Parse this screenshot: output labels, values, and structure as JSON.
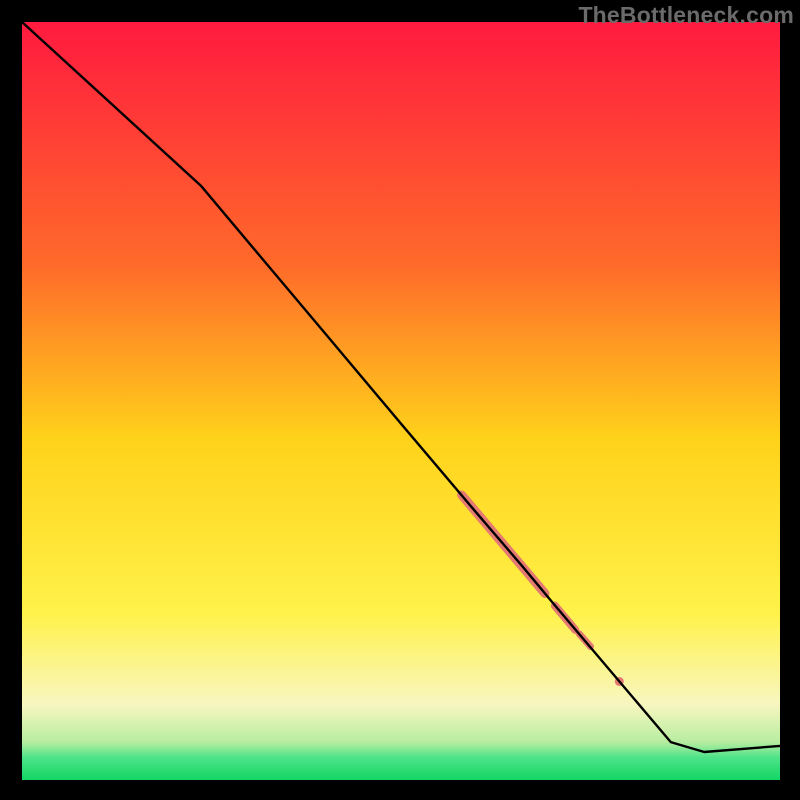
{
  "watermark": "TheBottleneck.com",
  "colors": {
    "red": "#ff1a3f",
    "orange": "#ff8a1f",
    "yellow": "#ffe617",
    "paleyellow": "#fdf6a7",
    "green": "#19e06b",
    "line": "#000000",
    "marker": "#e47a72",
    "bg": "#000000"
  },
  "chart_data": {
    "type": "line",
    "title": "",
    "xlabel": "",
    "ylabel": "",
    "xlim": [
      0,
      100
    ],
    "ylim": [
      0,
      100
    ],
    "grid": false,
    "legend": false,
    "description": "Monotonically decreasing bottleneck curve over a red→yellow→green vertical heat gradient. Thick salmon markers highlight a segment of the curve in the lower-right quadrant.",
    "series": [
      {
        "name": "bottleneck-curve",
        "x": [
          0.0,
          23.6,
          31.5,
          40.0,
          50.0,
          60.0,
          66.0,
          70.0,
          75.0,
          80.0,
          85.6,
          90.0,
          100.0
        ],
        "y": [
          100.0,
          78.4,
          69.0,
          58.9,
          47.0,
          35.2,
          28.2,
          23.4,
          17.5,
          11.6,
          5.0,
          3.7,
          4.5
        ]
      }
    ],
    "highlight_segments": [
      {
        "x": [
          58.0,
          69.0
        ],
        "y": [
          37.6,
          24.6
        ],
        "width": 9
      },
      {
        "x": [
          70.3,
          73.0
        ],
        "y": [
          23.0,
          19.8
        ],
        "width": 8
      },
      {
        "x": [
          73.5,
          75.0
        ],
        "y": [
          19.3,
          17.6
        ],
        "width": 7
      }
    ],
    "highlight_points": [
      {
        "x": 78.8,
        "y": 13.0,
        "r": 4.5
      }
    ],
    "gradient_stops_pct": [
      {
        "pct": 0,
        "color": "#ff1a3f"
      },
      {
        "pct": 32,
        "color": "#ff6a2a"
      },
      {
        "pct": 55,
        "color": "#ffd21a"
      },
      {
        "pct": 78,
        "color": "#fff24a"
      },
      {
        "pct": 90,
        "color": "#f8f6c0"
      },
      {
        "pct": 95,
        "color": "#b7eda0"
      },
      {
        "pct": 97,
        "color": "#4fe389"
      },
      {
        "pct": 100,
        "color": "#12d664"
      }
    ]
  }
}
